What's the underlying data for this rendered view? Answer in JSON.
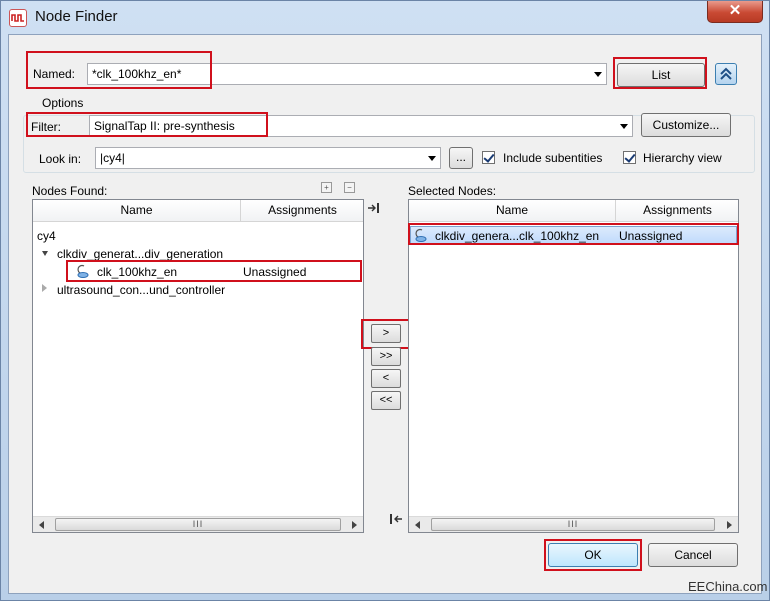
{
  "window": {
    "title": "Node Finder",
    "close_glyph": "✕"
  },
  "named": {
    "label": "Named:",
    "value": "*clk_100khz_en*"
  },
  "list_button": "List",
  "options": {
    "group_label": "Options",
    "filter_label": "Filter:",
    "filter_value": "SignalTap II: pre-synthesis",
    "customize_button": "Customize...",
    "lookin_label": "Look in:",
    "lookin_value": "|cy4|",
    "browse_button": "...",
    "include_subentities": "Include subentities",
    "hierarchy_view": "Hierarchy view"
  },
  "nodes_found": {
    "label": "Nodes Found:",
    "columns": [
      "Name",
      "Assignments"
    ],
    "root": "cy4",
    "child1": "clkdiv_generat...div_generation",
    "leaf": {
      "name": "clk_100khz_en",
      "assignment": "Unassigned"
    },
    "child2": "ultrasound_con...und_controller"
  },
  "transfer": {
    "add": ">",
    "add_all": ">>",
    "remove": "<",
    "remove_all": "<<"
  },
  "selected_nodes": {
    "label": "Selected Nodes:",
    "columns": [
      "Name",
      "Assignments"
    ],
    "row": {
      "name": "clkdiv_genera...clk_100khz_en",
      "assignment": "Unassigned"
    }
  },
  "scroll_thumb": "III",
  "ok_button": "OK",
  "cancel_button": "Cancel",
  "watermark": "EEChina.com",
  "colors": {
    "highlight": "#d0101c",
    "selection": "#c1dbfc"
  }
}
